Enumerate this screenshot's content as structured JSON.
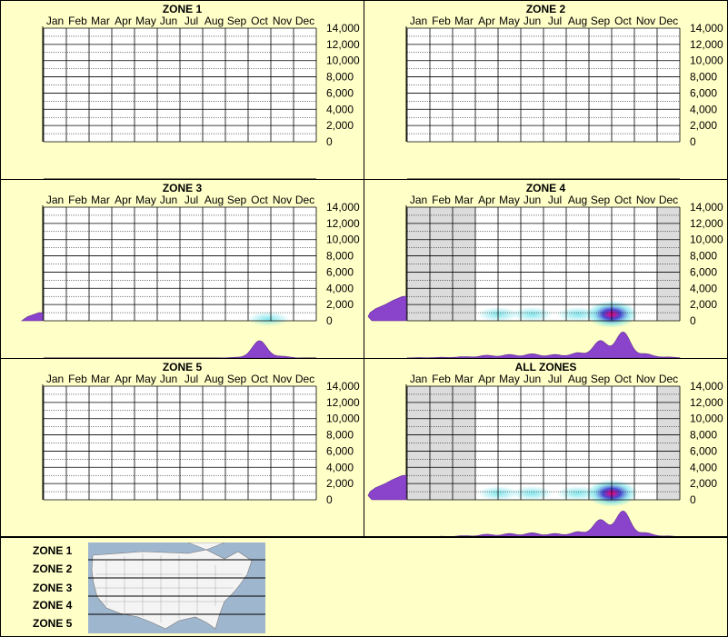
{
  "months": [
    "Jan",
    "Feb",
    "Mar",
    "Apr",
    "May",
    "Jun",
    "Jul",
    "Aug",
    "Sep",
    "Oct",
    "Nov",
    "Dec"
  ],
  "elevation_ticks": [
    "14,000",
    "12,000",
    "10,000",
    "8,000",
    "6,000",
    "4,000",
    "2,000",
    "0"
  ],
  "colors": {
    "background": "#ffffc8",
    "distribution": "#8a44cc",
    "heat_high": "#ff0080",
    "heat_mid": "#3333cc",
    "heat_low": "#66e0e8",
    "no_data_month": "#dcdcdc"
  },
  "chart_data": [
    {
      "title": "ZONE 1",
      "type": "heatmap",
      "x": [
        "Jan",
        "Feb",
        "Mar",
        "Apr",
        "May",
        "Jun",
        "Jul",
        "Aug",
        "Sep",
        "Oct",
        "Nov",
        "Dec"
      ],
      "ylim": [
        0,
        14000
      ],
      "has_data": false,
      "monthly_distribution": [],
      "elevation_distribution": [],
      "hotspots": [],
      "grey_months": []
    },
    {
      "title": "ZONE 2",
      "type": "heatmap",
      "x": [
        "Jan",
        "Feb",
        "Mar",
        "Apr",
        "May",
        "Jun",
        "Jul",
        "Aug",
        "Sep",
        "Oct",
        "Nov",
        "Dec"
      ],
      "ylim": [
        0,
        14000
      ],
      "has_data": false,
      "monthly_distribution": [],
      "elevation_distribution": [],
      "hotspots": [],
      "grey_months": []
    },
    {
      "title": "ZONE 3",
      "type": "heatmap",
      "x": [
        "Jan",
        "Feb",
        "Mar",
        "Apr",
        "May",
        "Jun",
        "Jul",
        "Aug",
        "Sep",
        "Oct",
        "Nov",
        "Dec"
      ],
      "ylim": [
        0,
        14000
      ],
      "has_data": true,
      "monthly_distribution": [
        0,
        0,
        0,
        0,
        0,
        0,
        0,
        0,
        0.02,
        0.5,
        0.05,
        0
      ],
      "elevation_distribution": [
        [
          0,
          0.55
        ],
        [
          500,
          0.4
        ],
        [
          1000,
          0.1
        ]
      ],
      "hotspots": [
        {
          "month": 10.4,
          "elevation": 200,
          "intensity": 0.3
        }
      ],
      "grey_months": []
    },
    {
      "title": "ZONE 4",
      "type": "heatmap",
      "x": [
        "Jan",
        "Feb",
        "Mar",
        "Apr",
        "May",
        "Jun",
        "Jul",
        "Aug",
        "Sep",
        "Oct",
        "Nov",
        "Dec"
      ],
      "ylim": [
        0,
        14000
      ],
      "has_data": true,
      "monthly_distribution": [
        0.01,
        0.02,
        0.04,
        0.08,
        0.1,
        0.12,
        0.1,
        0.15,
        0.5,
        0.75,
        0.12,
        0.03
      ],
      "elevation_distribution": [
        [
          0,
          0.9
        ],
        [
          500,
          1.0
        ],
        [
          1000,
          0.95
        ],
        [
          1500,
          0.8
        ],
        [
          2000,
          0.55
        ],
        [
          2500,
          0.35
        ],
        [
          3000,
          0.1
        ]
      ],
      "hotspots": [
        {
          "month": 9.5,
          "elevation": 800,
          "intensity": 1.0
        },
        {
          "month": 8.0,
          "elevation": 800,
          "intensity": 0.35
        },
        {
          "month": 6.0,
          "elevation": 800,
          "intensity": 0.3
        },
        {
          "month": 4.5,
          "elevation": 800,
          "intensity": 0.25
        }
      ],
      "grey_months": [
        "Jan",
        "Feb",
        "Mar",
        "Dec"
      ]
    },
    {
      "title": "ZONE 5",
      "type": "heatmap",
      "x": [
        "Jan",
        "Feb",
        "Mar",
        "Apr",
        "May",
        "Jun",
        "Jul",
        "Aug",
        "Sep",
        "Oct",
        "Nov",
        "Dec"
      ],
      "ylim": [
        0,
        14000
      ],
      "has_data": false,
      "monthly_distribution": [],
      "elevation_distribution": [],
      "hotspots": [],
      "grey_months": []
    },
    {
      "title": "ALL ZONES",
      "type": "heatmap",
      "x": [
        "Jan",
        "Feb",
        "Mar",
        "Apr",
        "May",
        "Jun",
        "Jul",
        "Aug",
        "Sep",
        "Oct",
        "Nov",
        "Dec"
      ],
      "ylim": [
        0,
        14000
      ],
      "has_data": true,
      "monthly_distribution": [
        0.01,
        0.02,
        0.04,
        0.08,
        0.1,
        0.12,
        0.1,
        0.15,
        0.5,
        0.75,
        0.12,
        0.03
      ],
      "elevation_distribution": [
        [
          0,
          0.9
        ],
        [
          500,
          1.0
        ],
        [
          1000,
          0.95
        ],
        [
          1500,
          0.8
        ],
        [
          2000,
          0.55
        ],
        [
          2500,
          0.35
        ],
        [
          3000,
          0.1
        ]
      ],
      "hotspots": [
        {
          "month": 9.5,
          "elevation": 800,
          "intensity": 1.0
        },
        {
          "month": 8.0,
          "elevation": 800,
          "intensity": 0.35
        },
        {
          "month": 6.0,
          "elevation": 800,
          "intensity": 0.3
        },
        {
          "month": 4.5,
          "elevation": 800,
          "intensity": 0.25
        }
      ],
      "grey_months": [
        "Jan",
        "Feb",
        "Mar",
        "Dec"
      ]
    }
  ],
  "legend": {
    "zones": [
      "ZONE 1",
      "ZONE 2",
      "ZONE 3",
      "ZONE 4",
      "ZONE 5"
    ]
  }
}
